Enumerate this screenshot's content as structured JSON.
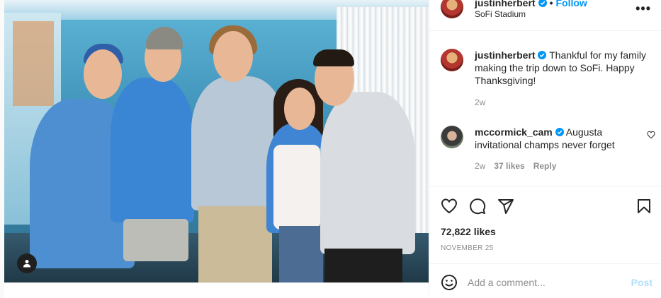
{
  "post": {
    "username": "justinherbert",
    "follow_label": "Follow",
    "location": "SoFi Stadium",
    "more_icon": "more-horizontal-icon"
  },
  "comments": [
    {
      "username": "justinherbert",
      "text": "Thankful for my family making the trip down to SoFi. Happy Thanksgiving!",
      "time": "2w"
    },
    {
      "username": "mccormick_cam",
      "text": "Augusta invitational champs never forget",
      "time": "2w",
      "likes": "37 likes",
      "reply_label": "Reply"
    }
  ],
  "actions": {
    "likes": "72,822 likes",
    "date": "NOVEMBER 25"
  },
  "add_comment": {
    "placeholder": "Add a comment...",
    "post_label": "Post"
  },
  "colors": {
    "link_blue": "#0095f6",
    "post_disabled": "#b2dffc",
    "muted": "#8e8e8e"
  }
}
